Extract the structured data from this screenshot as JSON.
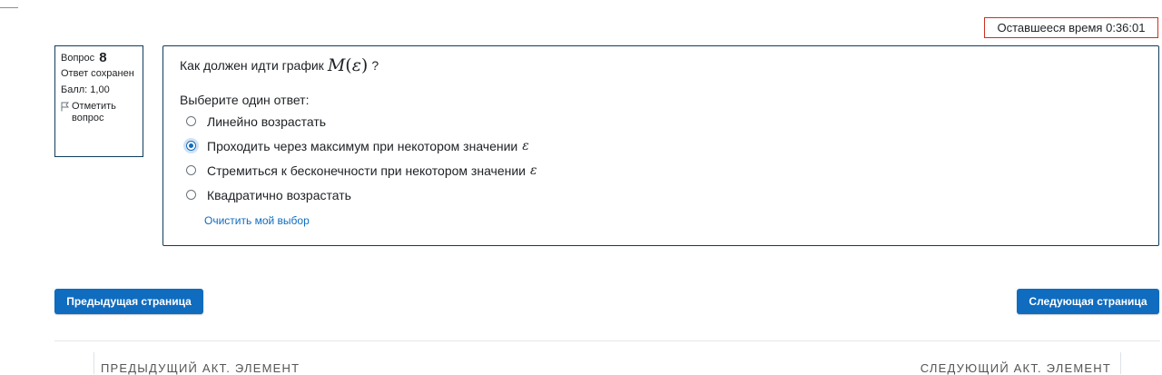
{
  "timer": {
    "label": "Оставшееся время",
    "value": "0:36:01"
  },
  "question_info": {
    "label": "Вопрос",
    "number": "8",
    "state": "Ответ сохранен",
    "grade": "Балл: 1,00",
    "flag_label": "Отметить вопрос"
  },
  "question": {
    "text": "Как должен идти график",
    "math_fn": "M",
    "math_open": "(",
    "math_var": "ε",
    "math_close": ")",
    "text_end": "?",
    "prompt": "Выберите один ответ:",
    "answers": [
      {
        "label": "Линейно возрастать",
        "suffix": "",
        "selected": false
      },
      {
        "label": "Проходить через максимум при некотором значении",
        "suffix": "ε",
        "selected": true
      },
      {
        "label": "Стремиться к бесконечности при некотором значении",
        "suffix": "ε",
        "selected": false
      },
      {
        "label": "Квадратично возрастать",
        "suffix": "",
        "selected": false
      }
    ],
    "clear_label": "Очистить мой выбор"
  },
  "navigation": {
    "prev_button": "Предыдущая страница",
    "next_button": "Следующая страница",
    "prev_activity": "ПРЕДЫДУЩИЙ АКТ. ЭЛЕМЕНТ",
    "next_activity": "СЛЕДУЮЩИЙ АКТ. ЭЛЕМЕНТ"
  },
  "colors": {
    "accent": "#0f6cbf",
    "border": "#0f3d5c",
    "timer_border": "#ca3120"
  },
  "icons": {
    "flag": "flag-icon"
  }
}
